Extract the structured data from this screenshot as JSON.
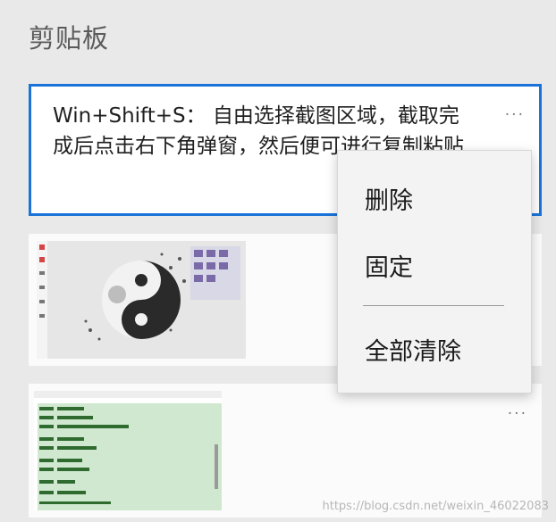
{
  "panel": {
    "title": "剪贴板"
  },
  "clip_text": {
    "content": "Win+Shift+S： 自由选择截图区域，截取完成后点击右下角弹窗，然后便可进行复制粘贴",
    "more": "···"
  },
  "clip_image2": {
    "more": "···"
  },
  "context_menu": {
    "delete_label": "删除",
    "pin_label": "固定",
    "clear_all_label": "全部清除"
  },
  "watermark": "https://blog.csdn.net/weixin_46022083",
  "colors": {
    "selected_border": "#1a73d9",
    "background": "#e9e9e9"
  }
}
